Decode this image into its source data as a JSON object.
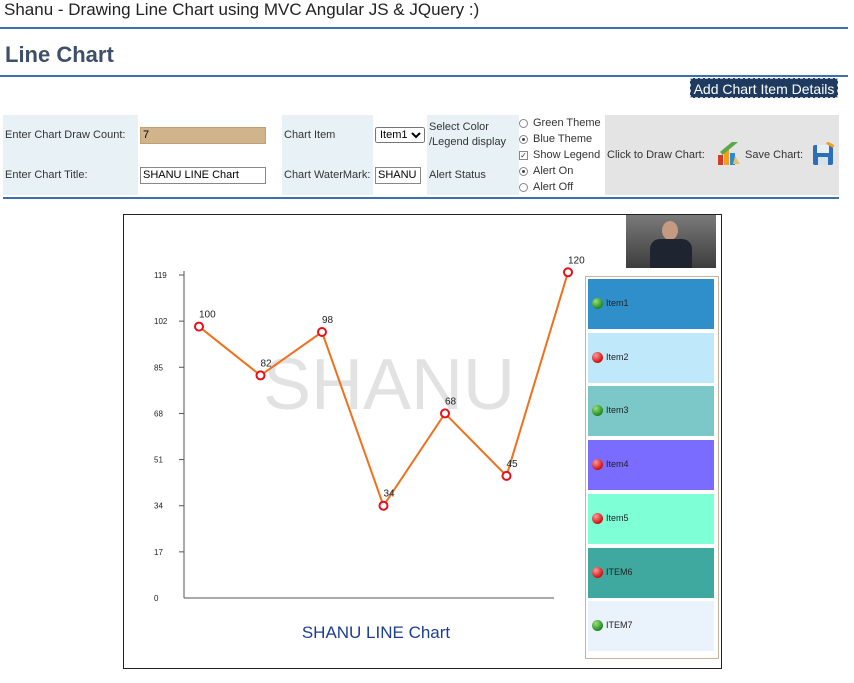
{
  "page": {
    "header": "Shanu - Drawing Line Chart using MVC Angular JS & JQuery :)",
    "section_title": "Line Chart",
    "add_button": "Add Chart Item Details"
  },
  "controls": {
    "count_label": "Enter Chart Draw Count:",
    "count_value": "7",
    "chart_title_label": "Enter Chart Title:",
    "chart_title_value": "SHANU LINE Chart",
    "chart_item_label": "Chart Item",
    "chart_item_selected": "Item1",
    "watermark_label": "Chart WaterMark:",
    "watermark_value": "SHANU",
    "color_label_1": "Select Color",
    "color_label_2": "/Legend display",
    "alert_status_label": "Alert Status",
    "options": [
      {
        "label": "Green Theme",
        "kind": "radio",
        "checked": false
      },
      {
        "label": "Blue Theme",
        "kind": "radio",
        "checked": true
      },
      {
        "label": "Show Legend",
        "kind": "checkbox",
        "checked": true
      },
      {
        "label": "Alert On",
        "kind": "radio",
        "checked": true
      },
      {
        "label": "Alert Off",
        "kind": "radio",
        "checked": false
      }
    ],
    "draw_label": "Click to Draw Chart:",
    "save_label": "Save Chart:"
  },
  "chart_data": {
    "type": "line",
    "title": "SHANU LINE Chart",
    "watermark": "SHANU",
    "y_ticks": [
      0,
      17,
      34,
      51,
      68,
      85,
      102,
      119
    ],
    "ylim": [
      0,
      119
    ],
    "values": [
      100,
      82,
      98,
      34,
      68,
      45,
      120
    ],
    "line_color": "#f0701c",
    "point_color": "#e8101a",
    "legend": [
      {
        "label": "Item1",
        "bg": "#2f8fca",
        "status": "green"
      },
      {
        "label": "Item2",
        "bg": "#bfe9fb",
        "status": "red"
      },
      {
        "label": "Item3",
        "bg": "#7cc8c8",
        "status": "green"
      },
      {
        "label": "Item4",
        "bg": "#7a6cff",
        "status": "red"
      },
      {
        "label": "Item5",
        "bg": "#7fffd6",
        "status": "red"
      },
      {
        "label": "ITEM6",
        "bg": "#3fa9a0",
        "status": "red"
      },
      {
        "label": "ITEM7",
        "bg": "#eaf3fb",
        "status": "green"
      }
    ]
  }
}
